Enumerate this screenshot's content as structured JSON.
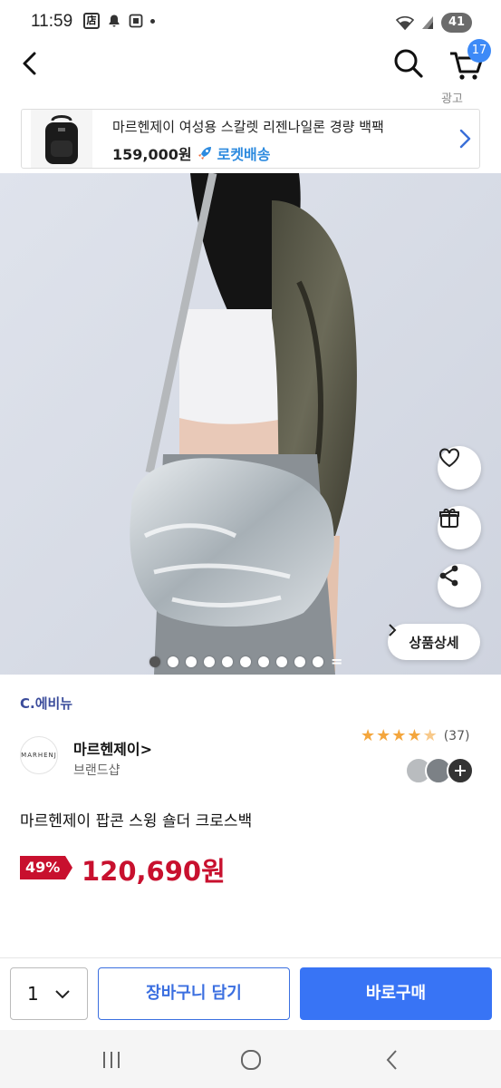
{
  "status_bar": {
    "time": "11:59",
    "store_badge": "店",
    "battery": "41"
  },
  "nav": {
    "cart_count": "17"
  },
  "ad": {
    "label": "광고",
    "title": "마르헨제이 여성용 스칼렛 리젠나일론 경량 백팩",
    "price": "159,000원",
    "delivery": "로켓배송"
  },
  "hero": {
    "detail_button": "상품상세",
    "image_count": 10,
    "active_index": 0
  },
  "product": {
    "brand_mark": "C.에비뉴",
    "brand_logo_text": "MARHENJ",
    "brand_name": "마르헨제이",
    "brand_sub": "브랜드샵",
    "rating": 4.5,
    "review_count": "(37)",
    "name": "마르헨제이 팝콘 스윙 숄더 크로스백",
    "discount": "49%",
    "price": "120,690원"
  },
  "purchase_bar": {
    "quantity": "1",
    "add_to_cart": "장바구니 담기",
    "buy_now": "바로구매"
  },
  "colors": {
    "accent": "#3874f5",
    "sale": "#c8102e",
    "rocket": "#2e8bdf",
    "star": "#f4a63d"
  }
}
